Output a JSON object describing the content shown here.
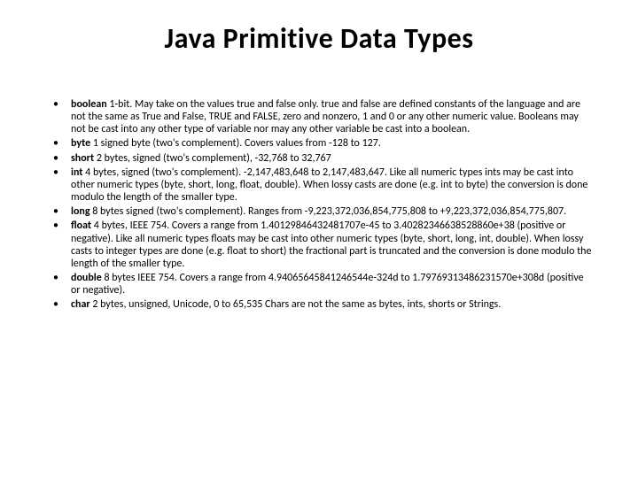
{
  "title": "Java Primitive Data Types",
  "items": [
    {
      "term": "boolean",
      "desc": " 1-bit. May take on the values true and false only. true and false are defined constants of the language and are not the same as True and False, TRUE and FALSE, zero and nonzero, 1 and 0 or any other numeric value. Booleans may not be cast into any other type of variable nor may any other variable be cast into a boolean."
    },
    {
      "term": "byte",
      "desc": " 1 signed byte (two's complement). Covers values from -128 to 127."
    },
    {
      "term": "short",
      "desc": " 2 bytes, signed (two's complement), -32,768 to 32,767"
    },
    {
      "term": "int",
      "desc": " 4 bytes, signed (two's complement). -2,147,483,648 to 2,147,483,647. Like all numeric types ints may be cast into other numeric types (byte, short, long, float, double). When lossy casts are done (e.g. int to byte) the conversion is done modulo the length of the smaller type."
    },
    {
      "term": "long",
      "desc": " 8 bytes signed (two's complement). Ranges from -9,223,372,036,854,775,808 to +9,223,372,036,854,775,807."
    },
    {
      "term": "float",
      "desc": " 4 bytes, IEEE 754. Covers a range from 1.40129846432481707e-45 to 3.40282346638528860e+38 (positive or negative). Like all numeric types floats may be cast into other numeric types (byte, short, long, int, double). When lossy casts to integer types are done (e.g. float to short) the fractional part is truncated and the conversion is done modulo the length of the smaller type."
    },
    {
      "term": "double",
      "desc": " 8 bytes IEEE 754. Covers a range from 4.94065645841246544e-324d to 1.79769313486231570e+308d (positive or negative)."
    },
    {
      "term": "char",
      "desc": " 2 bytes, unsigned, Unicode, 0 to 65,535 Chars are not the same as bytes, ints, shorts or Strings."
    }
  ]
}
